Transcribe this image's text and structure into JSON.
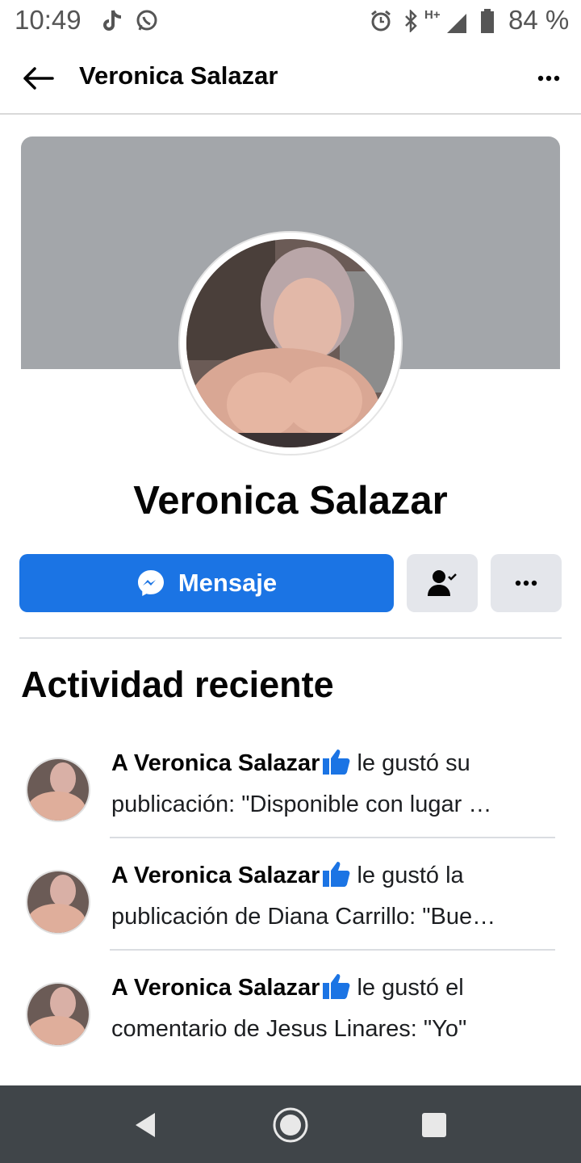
{
  "status_bar": {
    "time": "10:49",
    "battery": "84 %",
    "icons": [
      "tiktok-icon",
      "whatsapp-icon",
      "alarm-icon",
      "bluetooth-icon",
      "signal-hplus-icon",
      "battery-icon"
    ],
    "network": "H+"
  },
  "header": {
    "title": "Veronica Salazar",
    "back_icon": "arrow-left-icon",
    "more_icon": "ellipsis-icon"
  },
  "profile": {
    "name": "Veronica Salazar",
    "cover_color": "#a3a6aa"
  },
  "actions": {
    "message_label": "Mensaje",
    "message_color": "#1b74e4",
    "friend_icon": "friends-check-icon",
    "more_icon": "ellipsis-icon"
  },
  "activity": {
    "title": "Actividad reciente",
    "items": [
      {
        "name": "A Veronica Salazar",
        "line1_rest": "le gustó su",
        "line2": "publicación: \"Disponible con lugar …"
      },
      {
        "name": "A Veronica Salazar",
        "line1_rest": "le gustó la",
        "line2": "publicación de Diana Carrillo: \"Bue…"
      },
      {
        "name": "A Veronica Salazar",
        "line1_rest": "le gustó el",
        "line2": "comentario de Jesus Linares: \"Yo\""
      }
    ]
  },
  "nav": {
    "back_icon": "nav-back-icon",
    "home_icon": "nav-home-icon",
    "recents_icon": "nav-recents-icon"
  }
}
